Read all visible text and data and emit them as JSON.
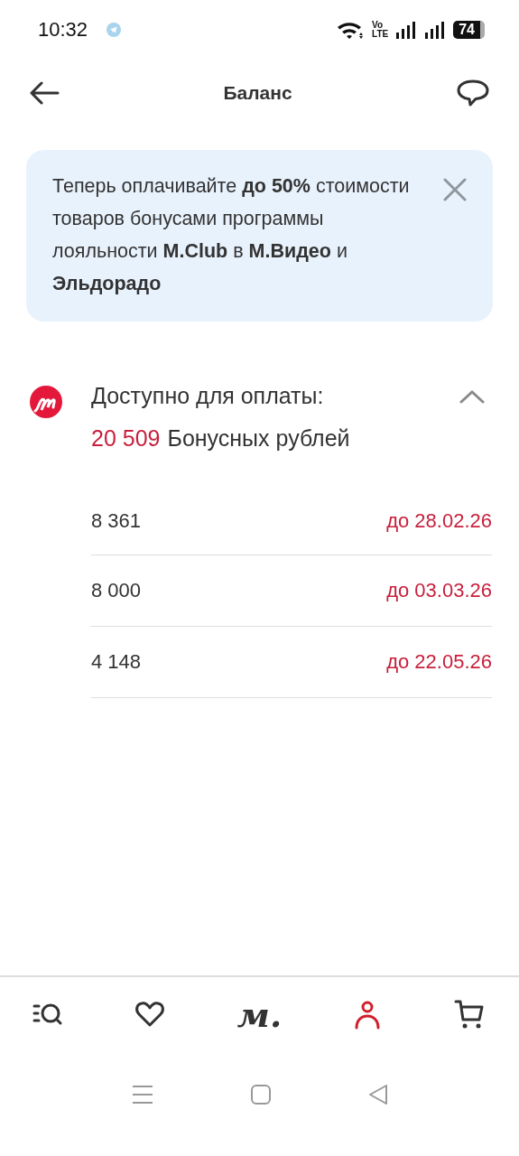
{
  "status_bar": {
    "time": "10:32",
    "network_top": "Vo",
    "network_bottom": "LTE",
    "battery": "74"
  },
  "header": {
    "title": "Баланс"
  },
  "banner": {
    "text": "Теперь оплачивайте **до 50%** стоимости товаров бонусами программы лояльности **M.Club** в **М.Видео** и **Эльдорадо**"
  },
  "balance": {
    "label": "Доступно для оплаты:",
    "amount": "20 509",
    "unit": "Бонусных рублей",
    "expanded": true,
    "items": [
      {
        "amount": "8 361",
        "expires": "до 28.02.26"
      },
      {
        "amount": "8 000",
        "expires": "до 03.03.26"
      },
      {
        "amount": "4 148",
        "expires": "до 22.05.26"
      }
    ]
  },
  "bottom_nav": [
    {
      "kind": "catalog",
      "selected": false
    },
    {
      "kind": "favorites",
      "selected": false
    },
    {
      "kind": "logo",
      "label": "м.",
      "selected": false
    },
    {
      "kind": "profile",
      "selected": true
    },
    {
      "kind": "cart",
      "selected": false
    }
  ]
}
